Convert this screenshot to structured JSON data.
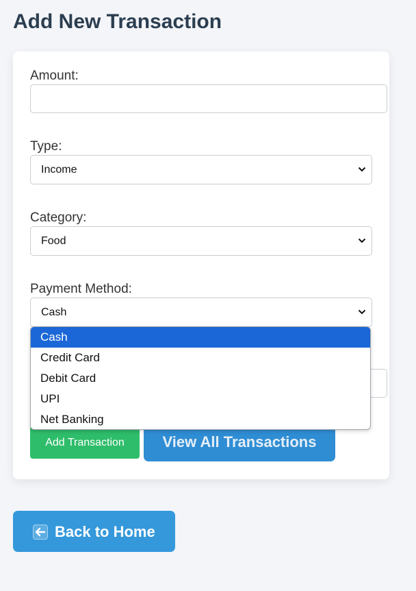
{
  "page": {
    "title": "Add New Transaction"
  },
  "form": {
    "amount": {
      "label": "Amount:",
      "value": "",
      "placeholder": ""
    },
    "type": {
      "label": "Type:",
      "selected": "Income"
    },
    "category": {
      "label": "Category:",
      "selected": "Food"
    },
    "payment_method": {
      "label": "Payment Method:",
      "selected": "Cash",
      "options": [
        "Cash",
        "Credit Card",
        "Debit Card",
        "UPI",
        "Net Banking"
      ]
    },
    "add_button_label": "Add Transaction",
    "view_all_button_label": "View All Transactions"
  },
  "nav": {
    "back_label": "Back to Home",
    "back_icon": "left-arrow-icon"
  },
  "colors": {
    "title": "#2c3e50",
    "add_button": "#2ebd6a",
    "view_button": "#2f8dd4",
    "back_button": "#3498db",
    "selected_option": "#1b67d8"
  }
}
